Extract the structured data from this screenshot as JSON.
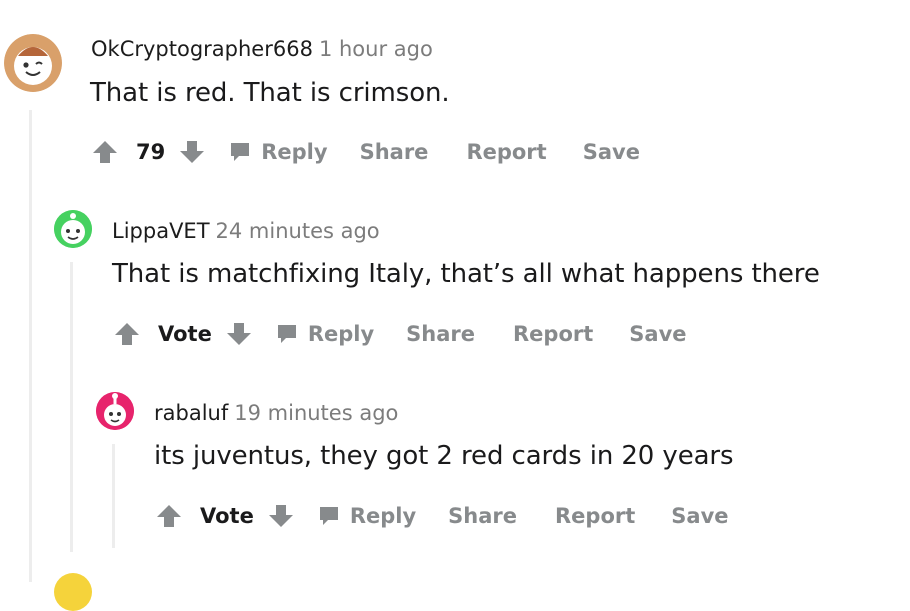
{
  "comments": [
    {
      "username": "OkCryptographer668",
      "time": "1 hour ago",
      "text": "That is red. That is crimson.",
      "score": "79",
      "avatar_color": "#cc7d3f"
    },
    {
      "username": "LippaVET",
      "time": "24 minutes ago",
      "text": "That is matchfixing Italy, that’s all what happens there",
      "score": "Vote",
      "avatar_color": "#46d160"
    },
    {
      "username": "rabaluf",
      "time": "19 minutes ago",
      "text": "its juventus, they got 2 red cards in 20 years",
      "score": "Vote",
      "avatar_color": "#e7246c"
    }
  ],
  "actions": {
    "reply": "Reply",
    "share": "Share",
    "report": "Report",
    "save": "Save"
  },
  "colors": {
    "action_gray": "#878a8c",
    "thread_line": "#ededed",
    "next_avatar": "#f5d33b"
  },
  "icons": [
    "upvote-arrow-icon",
    "downvote-arrow-icon",
    "reply-bubble-icon"
  ]
}
